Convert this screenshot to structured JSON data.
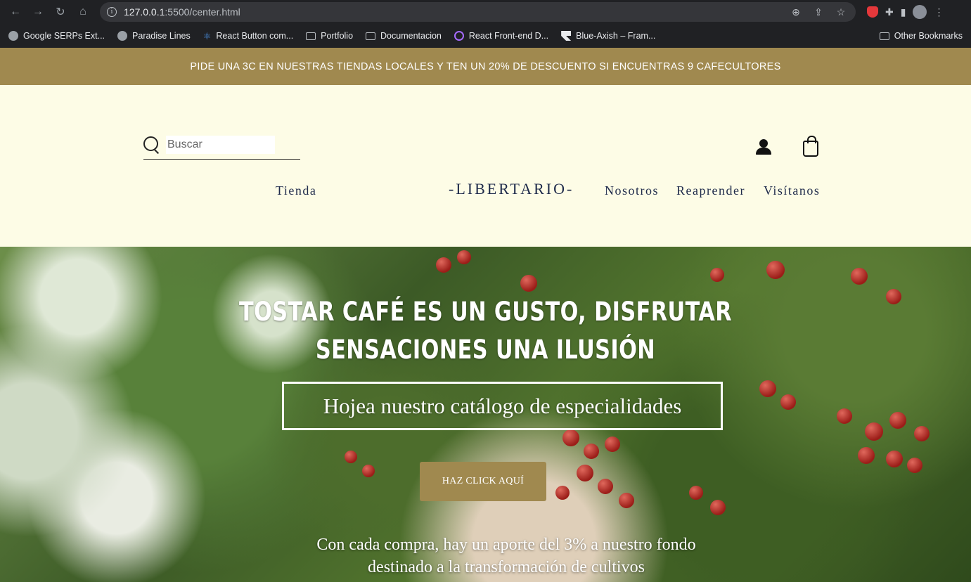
{
  "browser": {
    "url_host": "127.0.0.1",
    "url_rest": ":5500/center.html",
    "bookmarks": [
      {
        "label": "Google SERPs Ext...",
        "icon": "globe-icon"
      },
      {
        "label": "Paradise Lines",
        "icon": "globe-icon"
      },
      {
        "label": "React Button com...",
        "icon": "react-icon"
      },
      {
        "label": "Portfolio",
        "icon": "folder-icon"
      },
      {
        "label": "Documentacion",
        "icon": "folder-icon"
      },
      {
        "label": "React Front-end D...",
        "icon": "purple-site-icon"
      },
      {
        "label": "Blue-Axish – Fram...",
        "icon": "framer-icon"
      }
    ],
    "other_bookmarks": "Other Bookmarks"
  },
  "promo": {
    "text": "PIDE UNA 3C EN NUESTRAS TIENDAS LOCALES Y TEN UN 20% DE DESCUENTO SI ENCUENTRAS 9 CAFECULTORES"
  },
  "header": {
    "search_placeholder": "Buscar",
    "nav": {
      "tienda": "Tienda",
      "nosotros": "Nosotros",
      "reaprender": "Reaprender",
      "visitanos": "Visítanos"
    },
    "logo": "-LIBERTARIO-"
  },
  "hero": {
    "title_line1": "TOSTAR CAFÉ ES UN GUSTO, DISFRUTAR",
    "title_line2": "SENSACIONES UNA ILUSIÓN",
    "catalog": "Hojea nuestro catálogo de especialidades",
    "cta": "HAZ CLICK AQUÍ",
    "copy": "Con cada compra, hay un aporte del 3% a nuestro fondo destinado a la transformación de cultivos"
  },
  "colors": {
    "accent": "#a0894f",
    "header_bg": "#fdfce6",
    "nav_text": "#1e2a4a"
  }
}
